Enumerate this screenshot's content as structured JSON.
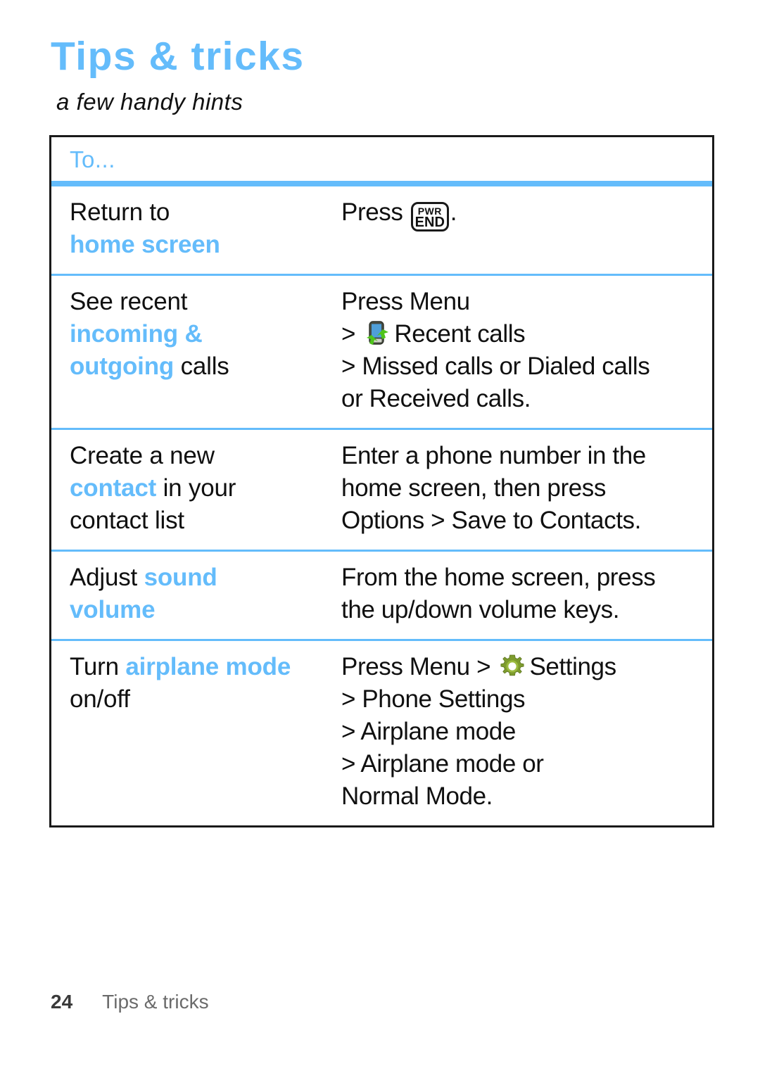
{
  "header": {
    "title": "Tips & tricks",
    "subtitle": "a few handy hints",
    "title_color": "#64bcfb"
  },
  "table": {
    "column_header": "To...",
    "rows": [
      {
        "todo": {
          "line1_plain": "Return to",
          "line2_highlight": "home screen"
        },
        "how": {
          "press_prefix": "Press",
          "key_icon": "pwr-end-key-icon",
          "key_top_label": "PWR",
          "key_bottom_label": "END",
          "press_suffix": "."
        }
      },
      {
        "todo": {
          "line1_plain": "See recent",
          "line2_highlight": "incoming &",
          "line3_highlight": "outgoing",
          "line3_plain": " calls"
        },
        "how": {
          "l1": "Press Menu",
          "l2_prefix": ">",
          "l2_icon": "recent-calls-icon",
          "l2_text": "Recent calls",
          "l3": "> Missed calls or Dialed calls",
          "l4": "or Received calls."
        }
      },
      {
        "todo": {
          "line1_plain": "Create a new",
          "line2_highlight": "contact",
          "line2_plain": " in your",
          "line3_plain": "contact list"
        },
        "how": {
          "l1": "Enter a phone number in the",
          "l2": "home screen, then press",
          "l3": "Options > Save to Contacts."
        }
      },
      {
        "todo": {
          "line1_plain": "Adjust ",
          "line1_highlight": "sound",
          "line2_highlight": "volume"
        },
        "how": {
          "l1": "From the home screen, press",
          "l2": "the up/down volume keys."
        }
      },
      {
        "todo": {
          "line1_plain": "Turn ",
          "line1_highlight": "airplane mode",
          "line2_plain": "on/off"
        },
        "how": {
          "l1_prefix": "Press Menu >",
          "l1_icon": "settings-gear-icon",
          "l1_text": "Settings",
          "l2": "> Phone Settings",
          "l3": "> Airplane mode",
          "l4": "> Airplane mode or",
          "l5": "Normal Mode."
        }
      }
    ]
  },
  "footer": {
    "page_number": "24",
    "section_label": "Tips & tricks"
  }
}
